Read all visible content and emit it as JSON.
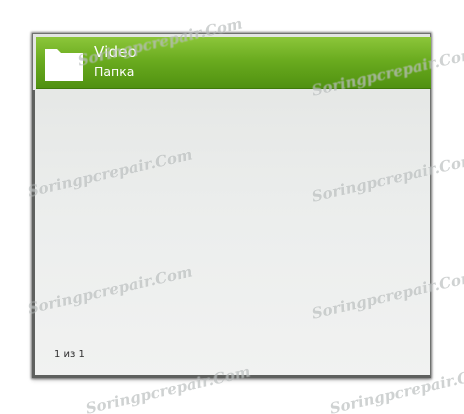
{
  "tile": {
    "title": "Video",
    "subtitle": "Папка",
    "icon": "folder-icon"
  },
  "pager": {
    "text": "1 из 1"
  },
  "watermark": {
    "text": "Soringpcrepair.Com"
  },
  "colors": {
    "tile_green": "#6aab1f",
    "panel_bg": "#eceeed",
    "border": "#6f716f"
  }
}
